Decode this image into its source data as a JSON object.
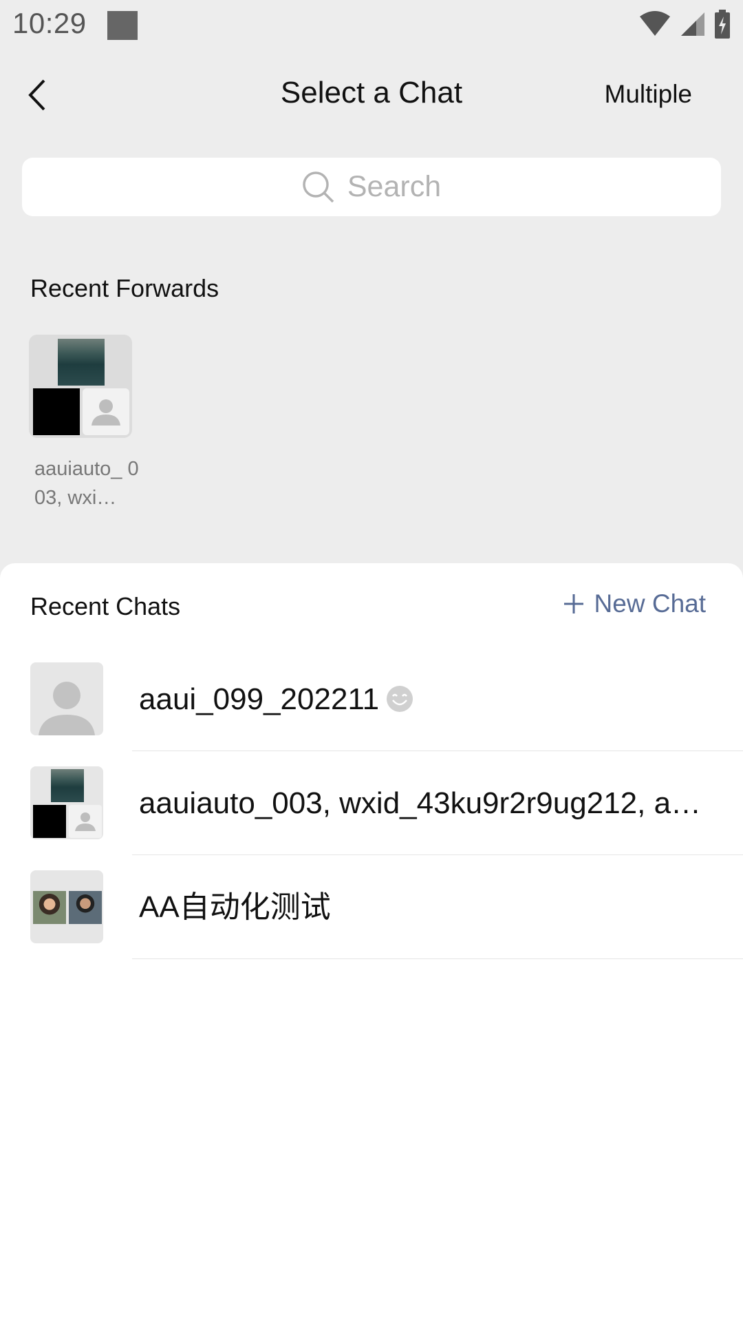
{
  "status_bar": {
    "time": "10:29"
  },
  "nav": {
    "title": "Select a Chat",
    "multiple_label": "Multiple"
  },
  "search": {
    "placeholder": "Search"
  },
  "recent_forwards": {
    "label": "Recent Forwards",
    "items": [
      {
        "name": "aauiauto_ 003, wxi…"
      }
    ]
  },
  "recent_chats": {
    "label": "Recent Chats",
    "new_chat_label": "New Chat",
    "items": [
      {
        "name": "aaui_099_202211"
      },
      {
        "name": "aauiauto_003, wxid_43ku9r2r9ug212, a…"
      },
      {
        "name": "AA自动化测试"
      }
    ]
  },
  "colors": {
    "background": "#ededed",
    "panel": "#ffffff",
    "link_blue": "#576b95",
    "placeholder_gray": "#b3b3b3"
  },
  "icons": [
    "back-chevron-icon",
    "search-icon",
    "plus-icon",
    "wifi-icon",
    "signal-icon",
    "battery-icon",
    "smiley-emoji-icon",
    "person-placeholder-icon"
  ]
}
